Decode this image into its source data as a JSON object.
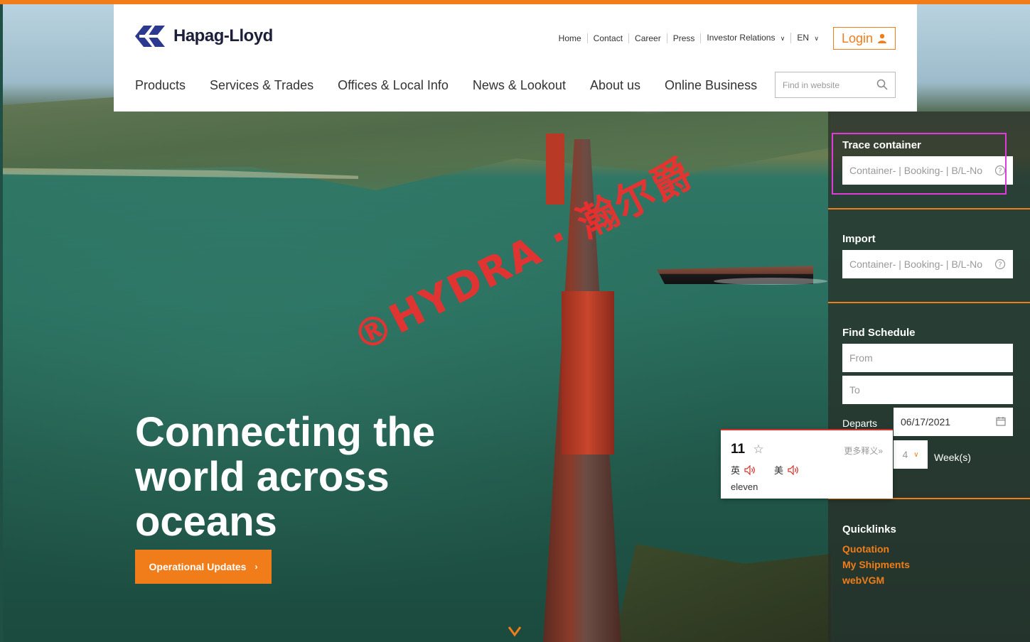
{
  "brand": {
    "name": "Hapag-Lloyd",
    "accent_color": "#f07d19",
    "logo_color": "#2b3a8e"
  },
  "util_nav": [
    {
      "label": "Home"
    },
    {
      "label": "Contact"
    },
    {
      "label": "Career"
    },
    {
      "label": "Press"
    },
    {
      "label": "Investor Relations",
      "icon": "chevron-down-icon"
    },
    {
      "label": "EN",
      "icon": "chevron-down-icon"
    }
  ],
  "login": {
    "label": "Login",
    "icon": "user-icon"
  },
  "main_nav": [
    {
      "label": "Products"
    },
    {
      "label": "Services & Trades"
    },
    {
      "label": "Offices & Local Info"
    },
    {
      "label": "News & Lookout"
    },
    {
      "label": "About us"
    },
    {
      "label": "Online Business"
    }
  ],
  "search": {
    "placeholder": "Find in website",
    "icon": "search-icon"
  },
  "panel": {
    "trace": {
      "title": "Trace container",
      "placeholder": "Container- | Booking- | B/L-No"
    },
    "import": {
      "title": "Import",
      "placeholder": "Container- | Booking- | B/L-No"
    },
    "schedule": {
      "title": "Find Schedule",
      "from_placeholder": "From",
      "to_placeholder": "To",
      "departs_label": "Departs",
      "departs_value": "06/17/2021",
      "weeks_value": "4",
      "weeks_label": "Week(s)"
    },
    "quicklinks": {
      "title": "Quicklinks",
      "items": [
        "Quotation",
        "My Shipments",
        "webVGM"
      ]
    }
  },
  "hero": {
    "headline_lines": [
      "Connecting the",
      "world across",
      "oceans"
    ],
    "button": "Operational Updates",
    "watermark": "®HYDRA · 瀚尔爵"
  },
  "popup": {
    "word": "11",
    "more": "更多释义»",
    "pron_uk": "英",
    "pron_us": "美",
    "definition": "eleven"
  }
}
